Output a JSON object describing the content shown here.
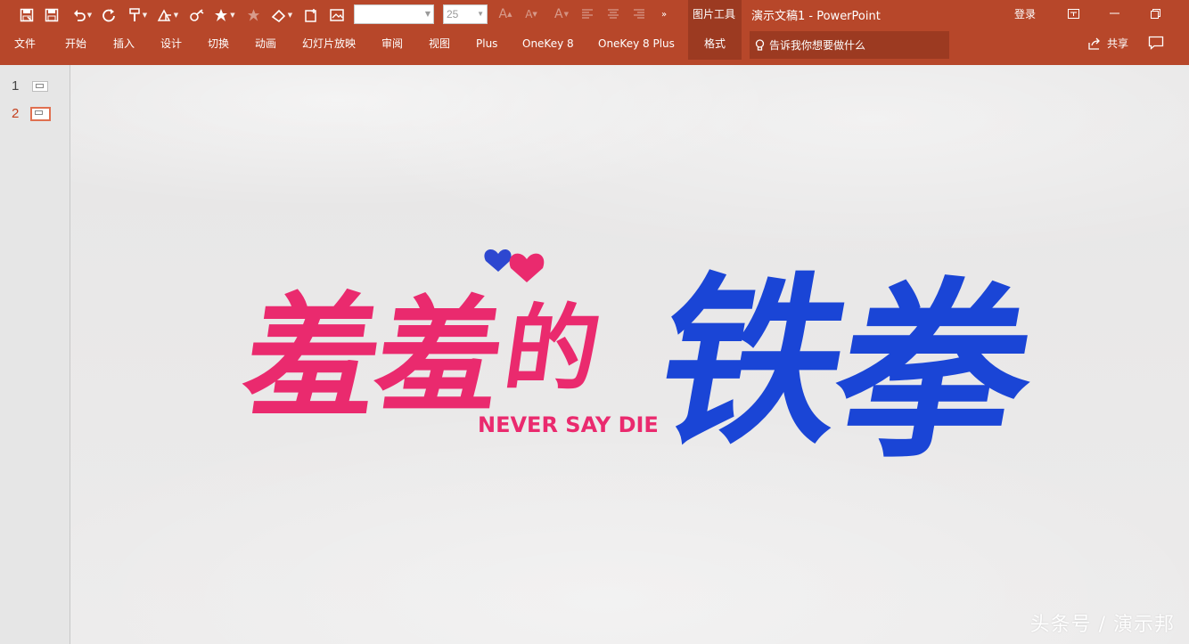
{
  "quick_access": {
    "icons": [
      "save-as-icon",
      "save-icon",
      "undo-icon",
      "redo-icon",
      "format-painter-icon",
      "shapes-icon",
      "lasso-icon",
      "animation-star-icon",
      "star-outline-icon",
      "eraser-icon",
      "new-slide-icon",
      "picture-icon",
      "increase-font-icon",
      "decrease-font-icon",
      "font-color-icon",
      "align-left-icon",
      "align-center-icon",
      "align-right-icon",
      "more-icon"
    ],
    "font_name": "",
    "font_size": "25"
  },
  "context_tool_label": "图片工具",
  "doc_title": "演示文稿1  -  PowerPoint",
  "login_label": "登录",
  "tabs": [
    {
      "label": "文件"
    },
    {
      "label": "开始"
    },
    {
      "label": "插入"
    },
    {
      "label": "设计"
    },
    {
      "label": "切换"
    },
    {
      "label": "动画"
    },
    {
      "label": "幻灯片放映"
    },
    {
      "label": "审阅"
    },
    {
      "label": "视图"
    },
    {
      "label": "Plus"
    },
    {
      "label": "OneKey 8"
    },
    {
      "label": "OneKey 8 Plus"
    },
    {
      "label": "格式"
    }
  ],
  "tell_me": "告诉我你想要做什么",
  "share_label": "共享",
  "slides": [
    {
      "number": "1"
    },
    {
      "number": "2"
    }
  ],
  "selected_slide": "2",
  "slide_content": {
    "title_pink": [
      "羞",
      "羞",
      "的"
    ],
    "title_blue": [
      "铁",
      "拳"
    ],
    "subtitle": "NEVER SAY DIE",
    "colors": {
      "pink": "#ea2a6e",
      "blue": "#1a45d6"
    }
  },
  "watermark": "头条号 / 演示邦",
  "colors": {
    "ribbon": "#b7472a",
    "ribbon_dark": "#9c3a21",
    "selection": "#c43e1c"
  }
}
